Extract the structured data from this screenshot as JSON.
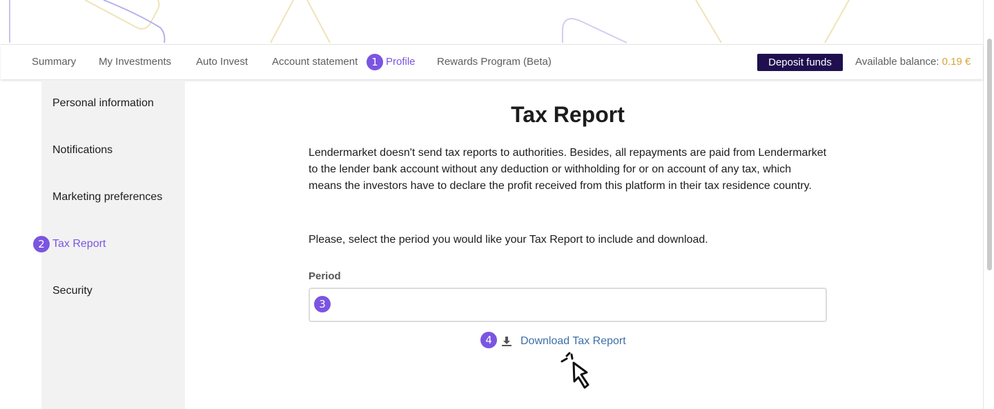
{
  "colors": {
    "accent": "#7b55e0",
    "deposit_button": "#1f0f4f",
    "balance_value": "#d9a535",
    "link": "#3d6fa8",
    "sidebar_bg": "#f2f2f2"
  },
  "topnav": {
    "items": [
      {
        "label": "Summary"
      },
      {
        "label": "My Investments"
      },
      {
        "label": "Auto Invest"
      },
      {
        "label": "Account statement"
      },
      {
        "label": "Profile",
        "active": true,
        "step": "1"
      },
      {
        "label": "Rewards Program (Beta)"
      }
    ],
    "deposit_label": "Deposit funds",
    "balance_label": "Available balance: ",
    "balance_value": "0.19 €"
  },
  "sidebar": {
    "items": [
      {
        "label": "Personal information"
      },
      {
        "label": "Notifications"
      },
      {
        "label": "Marketing preferences"
      },
      {
        "label": "Tax Report",
        "active": true,
        "step": "2"
      },
      {
        "label": "Security"
      }
    ]
  },
  "main": {
    "title": "Tax Report",
    "description": "Lendermarket doesn't send tax reports to authorities. Besides, all repayments are paid from Lendermarket to the lender bank account without any deduction or withholding for or on account of any tax, which means the investors have to declare the profit received from this platform in their tax residence country.",
    "instruction": "Please, select the period you would like your Tax Report to include and download.",
    "period_label": "Period",
    "period_value": "",
    "period_step": "3",
    "download_label": "Download Tax Report",
    "download_step": "4",
    "download_icon": "download-icon"
  }
}
